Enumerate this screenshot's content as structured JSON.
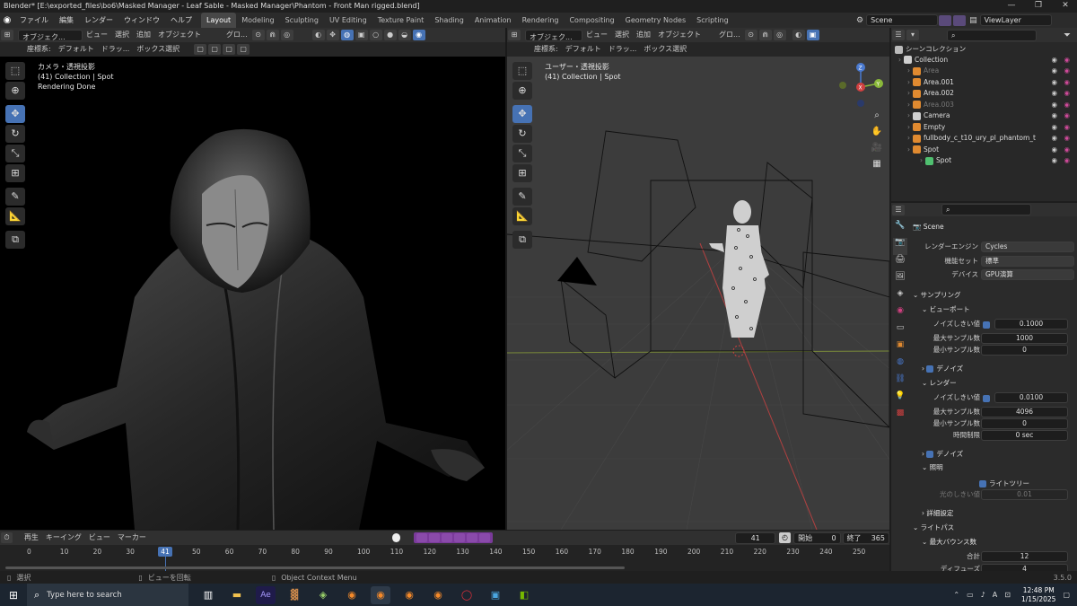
{
  "window": {
    "title": "Blender* [E:\\exported_files\\bo6\\Masked Manager - Leaf Sable - Masked Manager\\Phantom - Front Man rigged.blend]"
  },
  "menubar": {
    "menus": [
      "ファイル",
      "編集",
      "レンダー",
      "ウィンドウ",
      "ヘルプ"
    ],
    "workspaces": [
      "Layout",
      "Modeling",
      "Sculpting",
      "UV Editing",
      "Texture Paint",
      "Shading",
      "Animation",
      "Rendering",
      "Compositing",
      "Geometry Nodes",
      "Scripting"
    ],
    "active_workspace": "Layout",
    "scene": "Scene",
    "view_layer": "ViewLayer"
  },
  "viewport_left": {
    "mode": "オブジェク...",
    "menus": [
      "ビュー",
      "選択",
      "追加",
      "オブジェクト"
    ],
    "transform": "グロ...",
    "coord_label": "座標系:",
    "coord_value": "デフォルト",
    "drag_label": "ドラッ...",
    "select_box": "ボックス選択",
    "info_line1": "カメラ・透視投影",
    "info_line2": "(41) Collection | Spot",
    "info_line3": "Rendering Done"
  },
  "viewport_right": {
    "mode": "オブジェク...",
    "menus": [
      "ビュー",
      "選択",
      "追加",
      "オブジェクト"
    ],
    "transform": "グロ...",
    "coord_label": "座標系:",
    "coord_value": "デフォルト",
    "drag_label": "ドラッ...",
    "select_box": "ボックス選択",
    "info_line1": "ユーザー・透視投影",
    "info_line2": "(41) Collection | Spot",
    "gizmo_x": "X",
    "gizmo_y": "Y",
    "gizmo_z": "Z"
  },
  "outliner": {
    "header": "シーンコレクション",
    "items": [
      {
        "label": "Collection",
        "dim": false
      },
      {
        "label": "Area",
        "dim": true
      },
      {
        "label": "Area.001",
        "dim": false
      },
      {
        "label": "Area.002",
        "dim": false
      },
      {
        "label": "Area.003",
        "dim": true
      },
      {
        "label": "Camera",
        "dim": false
      },
      {
        "label": "Empty",
        "dim": false
      },
      {
        "label": "fullbody_c_t10_ury_pl_phantom_t",
        "dim": false
      },
      {
        "label": "Spot",
        "dim": false
      },
      {
        "label": "Spot",
        "dim": false
      }
    ]
  },
  "properties": {
    "scene_label": "Scene",
    "render_engine_label": "レンダーエンジン",
    "render_engine": "Cycles",
    "feature_set_label": "機能セット",
    "feature_set": "標準",
    "device_label": "デバイス",
    "device": "GPU演算",
    "sampling": "サンプリング",
    "viewport": "ビューポート",
    "noise_threshold_label": "ノイズしきい値",
    "vp_noise_threshold": "0.1000",
    "max_samples_label": "最大サンプル数",
    "vp_max_samples": "1000",
    "min_samples_label": "最小サンプル数",
    "vp_min_samples": "0",
    "denoise": "デノイズ",
    "render": "レンダー",
    "r_noise_threshold": "0.0100",
    "r_max_samples": "4096",
    "r_min_samples": "0",
    "time_limit_label": "時間制限",
    "r_time_limit": "0 sec",
    "denoise2": "デノイズ",
    "lights": "照明",
    "light_tree": "ライトツリー",
    "light_threshold_label": "光のしきい値",
    "light_threshold": "0.01",
    "advanced": "詳細設定",
    "light_paths": "ライトパス",
    "max_bounces": "最大バウンス数",
    "total_label": "合計",
    "total": "12",
    "diffuse_label": "ディフューズ",
    "diffuse": "4"
  },
  "timeline": {
    "menus": [
      "再生",
      "キーイング",
      "ビュー",
      "マーカー"
    ],
    "current_frame": "41",
    "start_label": "開始",
    "start": "0",
    "end_label": "終了",
    "end": "365",
    "ticks": [
      "0",
      "10",
      "20",
      "30",
      "40",
      "50",
      "60",
      "70",
      "80",
      "90",
      "100",
      "110",
      "120",
      "130",
      "140",
      "150",
      "160",
      "170",
      "180",
      "190",
      "200",
      "210",
      "220",
      "230",
      "240",
      "250"
    ]
  },
  "statusbar": {
    "select": "選択",
    "rotate_view": "ビューを回転",
    "context_menu": "Object Context Menu",
    "version": "3.5.0"
  },
  "taskbar": {
    "search_placeholder": "Type here to search",
    "time": "12:48 PM",
    "date": "1/15/2025"
  },
  "colors": {
    "accent": "#4672b4",
    "bg": "#1d1d1d"
  }
}
